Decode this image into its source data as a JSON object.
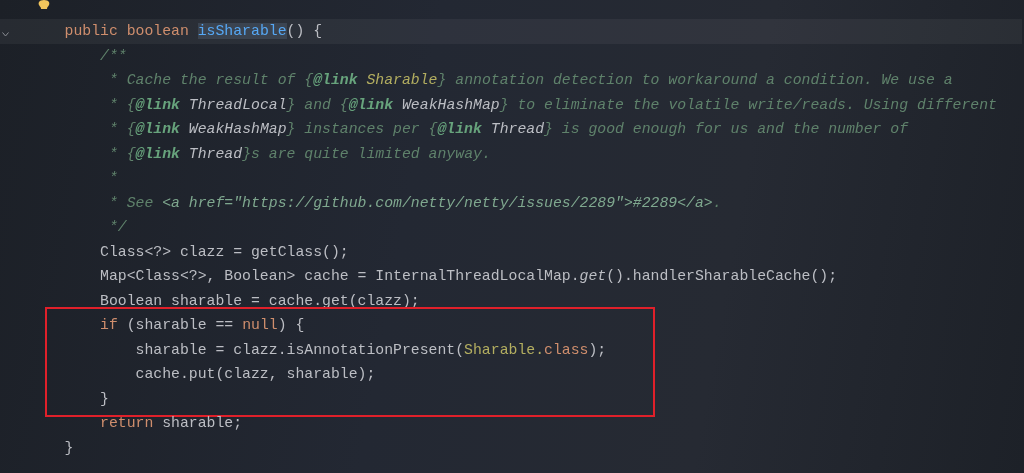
{
  "editor": {
    "lines": [
      {
        "current": true,
        "boxed": false,
        "tokens": [
          {
            "text": "    public boolean ",
            "kind": "keyword"
          },
          {
            "text": "isSharable",
            "kind": "method-highlight"
          },
          {
            "text": "() {",
            "kind": "plain"
          }
        ]
      },
      {
        "current": false,
        "boxed": false,
        "tokens": [
          {
            "text": "        /**",
            "kind": "comment"
          }
        ]
      },
      {
        "current": false,
        "boxed": false,
        "tokens": [
          {
            "text": "         * Cache the result of ",
            "kind": "comment"
          },
          {
            "text": "{",
            "kind": "comment"
          },
          {
            "text": "@link",
            "kind": "doc-tag"
          },
          {
            "text": " Sharable",
            "kind": "doc-annotation"
          },
          {
            "text": "} annotation detection to workaround a condition. We use a",
            "kind": "comment"
          }
        ]
      },
      {
        "current": false,
        "boxed": false,
        "tokens": [
          {
            "text": "         * {",
            "kind": "comment"
          },
          {
            "text": "@link",
            "kind": "doc-tag"
          },
          {
            "text": " ThreadLocal",
            "kind": "doc-ref"
          },
          {
            "text": "} and {",
            "kind": "comment"
          },
          {
            "text": "@link",
            "kind": "doc-tag"
          },
          {
            "text": " WeakHashMap",
            "kind": "doc-ref"
          },
          {
            "text": "} to eliminate the volatile write/reads. Using different",
            "kind": "comment"
          }
        ]
      },
      {
        "current": false,
        "boxed": false,
        "tokens": [
          {
            "text": "         * {",
            "kind": "comment"
          },
          {
            "text": "@link",
            "kind": "doc-tag"
          },
          {
            "text": " WeakHashMap",
            "kind": "doc-ref"
          },
          {
            "text": "} instances per {",
            "kind": "comment"
          },
          {
            "text": "@link",
            "kind": "doc-tag"
          },
          {
            "text": " Thread",
            "kind": "doc-ref"
          },
          {
            "text": "} is good enough for us and the number of",
            "kind": "comment"
          }
        ]
      },
      {
        "current": false,
        "boxed": false,
        "tokens": [
          {
            "text": "         * {",
            "kind": "comment"
          },
          {
            "text": "@link",
            "kind": "doc-tag"
          },
          {
            "text": " Thread",
            "kind": "doc-ref"
          },
          {
            "text": "}s are quite limited anyway.",
            "kind": "comment"
          }
        ]
      },
      {
        "current": false,
        "boxed": false,
        "tokens": [
          {
            "text": "         *",
            "kind": "comment"
          }
        ]
      },
      {
        "current": false,
        "boxed": false,
        "tokens": [
          {
            "text": "         * See ",
            "kind": "comment"
          },
          {
            "text": "<a href=\"https://github.com/netty/netty/issues/2289\">#2289</a>",
            "kind": "doc-html"
          },
          {
            "text": ".",
            "kind": "comment"
          }
        ]
      },
      {
        "current": false,
        "boxed": false,
        "tokens": [
          {
            "text": "         */",
            "kind": "comment"
          }
        ]
      },
      {
        "current": false,
        "boxed": false,
        "tokens": [
          {
            "text": "        Class<?> clazz = getClass();",
            "kind": "plain"
          }
        ]
      },
      {
        "current": false,
        "boxed": false,
        "tokens": [
          {
            "text": "        Map<Class<?>, Boolean> cache = InternalThreadLocalMap.",
            "kind": "plain"
          },
          {
            "text": "get",
            "kind": "static-call"
          },
          {
            "text": "().handlerSharableCache();",
            "kind": "plain"
          }
        ]
      },
      {
        "current": false,
        "boxed": false,
        "tokens": [
          {
            "text": "        Boolean sharable = cache.get(clazz);",
            "kind": "plain"
          }
        ]
      },
      {
        "current": false,
        "boxed": true,
        "tokens": [
          {
            "text": "        if",
            "kind": "keyword"
          },
          {
            "text": " (sharable == ",
            "kind": "plain"
          },
          {
            "text": "null",
            "kind": "keyword"
          },
          {
            "text": ") {",
            "kind": "plain"
          }
        ]
      },
      {
        "current": false,
        "boxed": true,
        "tokens": [
          {
            "text": "            sharable = clazz.isAnnotationPresent(",
            "kind": "plain"
          },
          {
            "text": "Sharable.",
            "kind": "annotation"
          },
          {
            "text": "class",
            "kind": "keyword"
          },
          {
            "text": ");",
            "kind": "plain"
          }
        ]
      },
      {
        "current": false,
        "boxed": true,
        "tokens": [
          {
            "text": "            cache.put(clazz, sharable);",
            "kind": "plain"
          }
        ]
      },
      {
        "current": false,
        "boxed": true,
        "tokens": [
          {
            "text": "        }",
            "kind": "plain"
          }
        ]
      },
      {
        "current": false,
        "boxed": false,
        "tokens": [
          {
            "text": "        return",
            "kind": "keyword"
          },
          {
            "text": " sharable;",
            "kind": "plain"
          }
        ]
      },
      {
        "current": false,
        "boxed": false,
        "tokens": [
          {
            "text": "    }",
            "kind": "plain"
          }
        ]
      }
    ]
  }
}
